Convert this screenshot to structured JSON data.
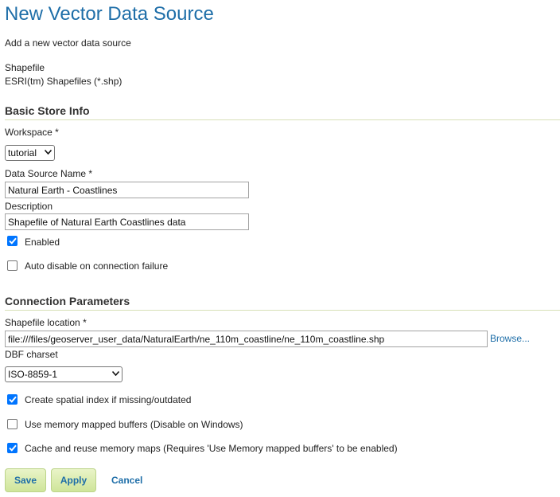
{
  "page": {
    "title": "New Vector Data Source",
    "description": "Add a new vector data source"
  },
  "store_type": {
    "name": "Shapefile",
    "description": "ESRI(tm) Shapefiles (*.shp)"
  },
  "basic_store_info": {
    "heading": "Basic Store Info",
    "workspace_label": "Workspace *",
    "workspace_value": "tutorial",
    "name_label": "Data Source Name *",
    "name_value": "Natural Earth - Coastlines",
    "description_label": "Description",
    "description_value": "Shapefile of Natural Earth Coastlines data",
    "enabled_label": "Enabled",
    "enabled_checked": true,
    "auto_disable_label": "Auto disable on connection failure",
    "auto_disable_checked": false
  },
  "connection_parameters": {
    "heading": "Connection Parameters",
    "location_label": "Shapefile location *",
    "location_value": "file:///files/geoserver_user_data/NaturalEarth/ne_110m_coastline/ne_110m_coastline.shp",
    "browse_label": "Browse...",
    "charset_label": "DBF charset",
    "charset_value": "ISO-8859-1",
    "spatial_index_label": "Create spatial index if missing/outdated",
    "spatial_index_checked": true,
    "memory_mapped_label": "Use memory mapped buffers (Disable on Windows)",
    "memory_mapped_checked": false,
    "cache_label": "Cache and reuse memory maps (Requires 'Use Memory mapped buffers' to be enabled)",
    "cache_checked": true
  },
  "actions": {
    "save_label": "Save",
    "apply_label": "Apply",
    "cancel_label": "Cancel"
  },
  "icons": {
    "checkbox_checked": "checkmark-icon",
    "dropdown": "chevron-down-icon"
  }
}
